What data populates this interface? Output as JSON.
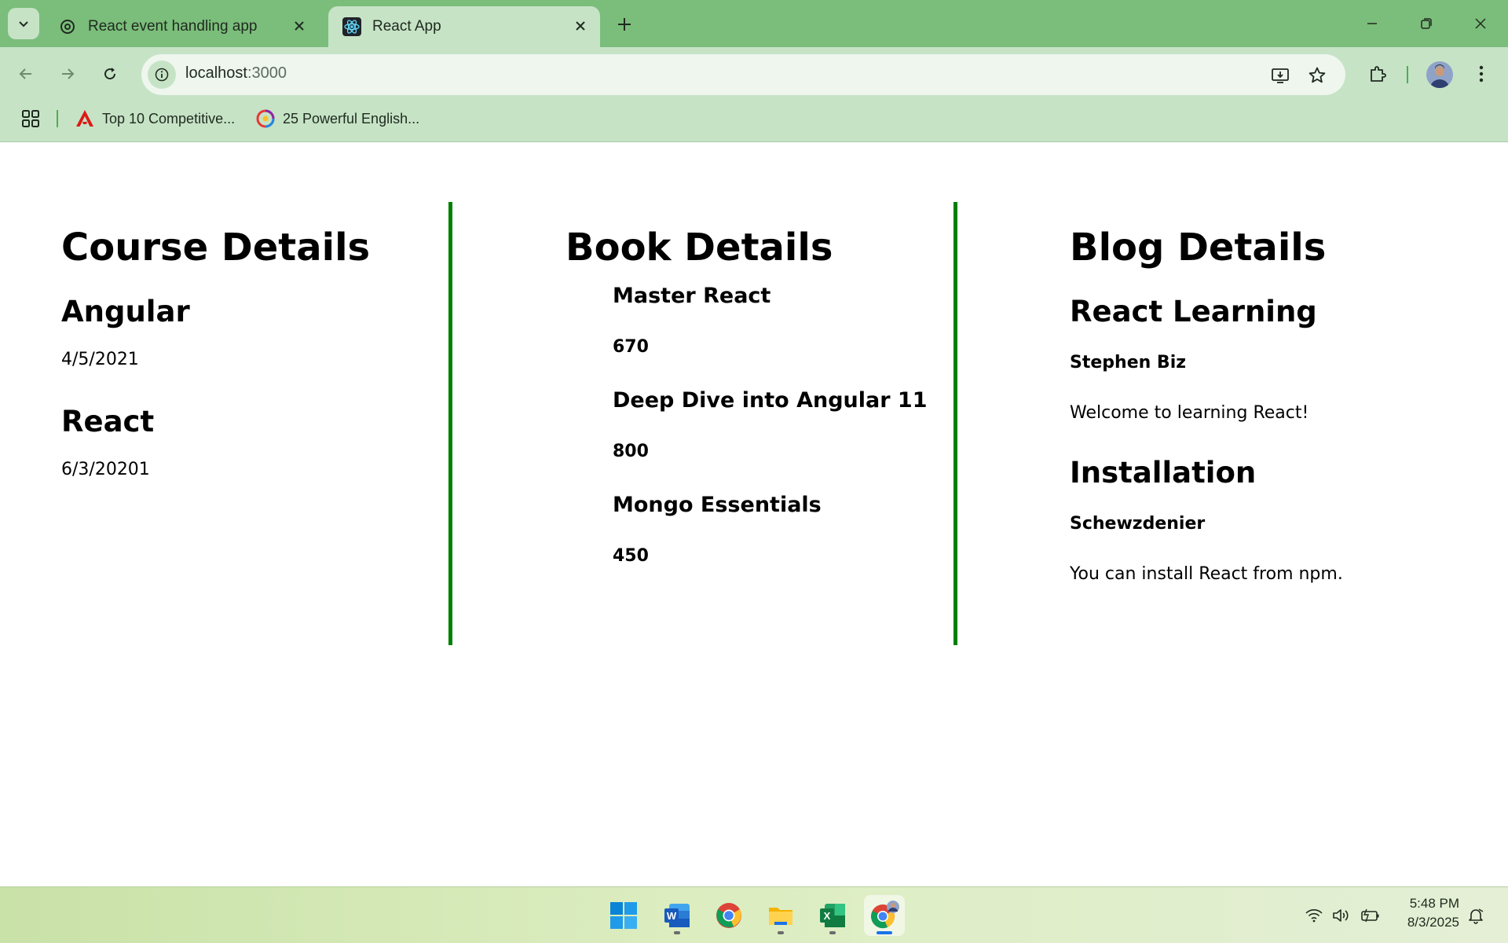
{
  "browser": {
    "tabs": [
      {
        "title": "React event handling app",
        "icon": "openai-icon",
        "active": false
      },
      {
        "title": "React App",
        "icon": "react-icon",
        "active": true
      }
    ],
    "address": {
      "host": "localhost",
      "port": ":3000"
    },
    "bookmarks": [
      {
        "label": "Top 10 Competitive...",
        "icon": "angular-icon"
      },
      {
        "label": "25 Powerful English...",
        "icon": "colorful-logo-icon"
      }
    ]
  },
  "course": {
    "title": "Course Details",
    "items": [
      {
        "name": "Angular",
        "date": "4/5/2021"
      },
      {
        "name": "React",
        "date": "6/3/20201"
      }
    ]
  },
  "books": {
    "title": "Book Details",
    "items": [
      {
        "name": "Master React",
        "price": "670"
      },
      {
        "name": "Deep Dive into Angular 11",
        "price": "800"
      },
      {
        "name": "Mongo Essentials",
        "price": "450"
      }
    ]
  },
  "blog": {
    "title": "Blog Details",
    "items": [
      {
        "title": "React Learning",
        "author": "Stephen Biz",
        "content": "Welcome to learning React!"
      },
      {
        "title": "Installation",
        "author": "Schewzdenier",
        "content": "You can install React from npm."
      }
    ]
  },
  "taskbar": {
    "apps": [
      "windows-start-icon",
      "word-icon",
      "chrome-icon",
      "file-explorer-icon",
      "excel-icon",
      "chrome-profile-icon"
    ],
    "time": "5:48 PM",
    "date": "8/3/2025"
  },
  "colors": {
    "divider": "#008000",
    "chrome": "#7bbd7b",
    "toolbar": "#c6e3c6"
  }
}
